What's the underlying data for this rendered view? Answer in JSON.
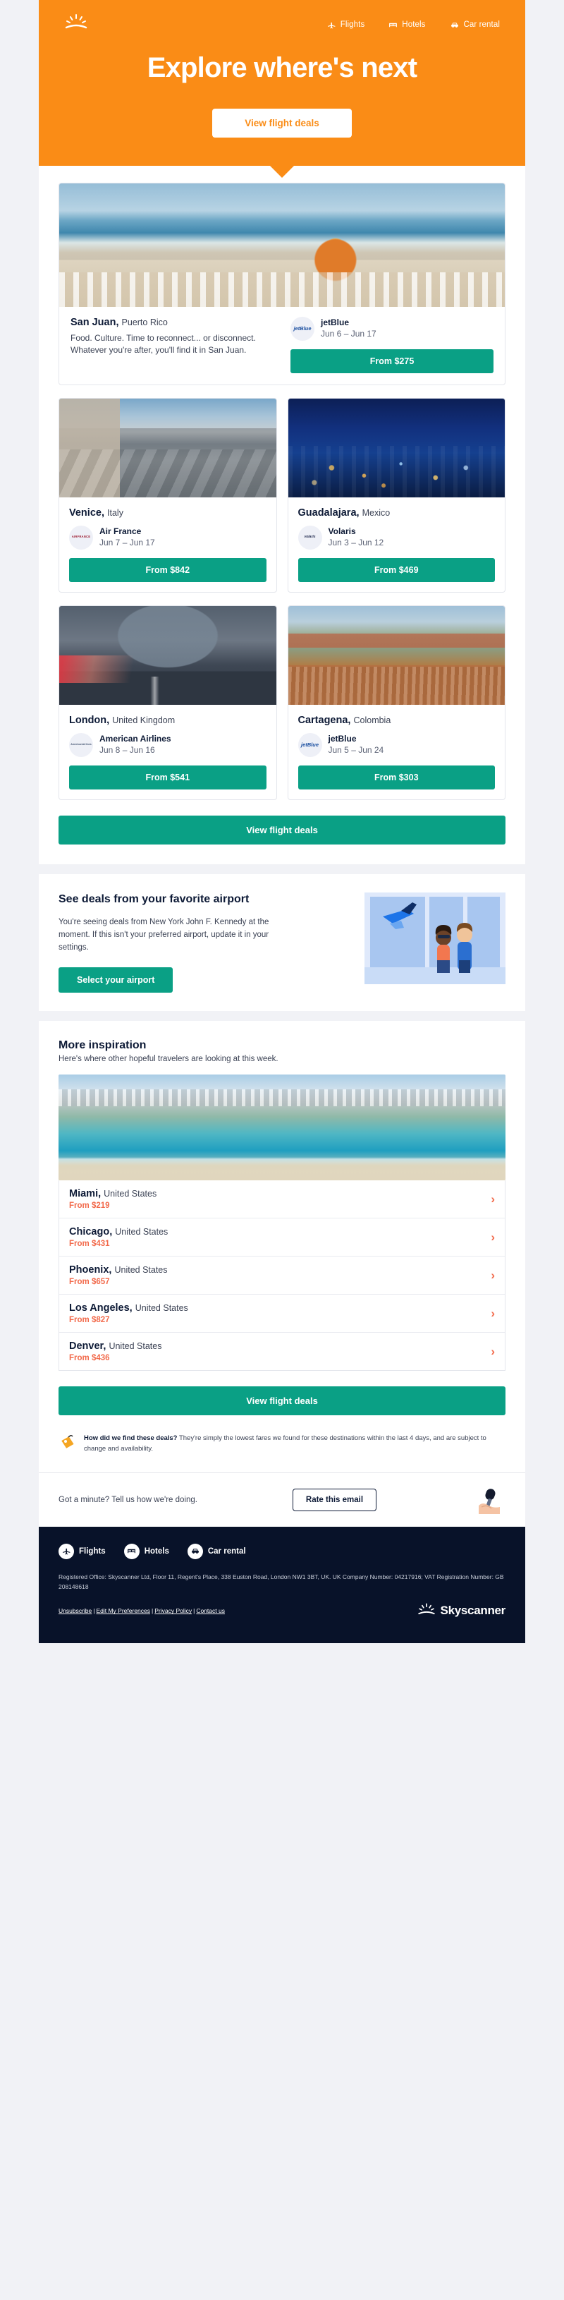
{
  "hero": {
    "logo_icon": "skyscanner-sun-icon",
    "nav": [
      {
        "label": "Flights",
        "icon": "plane-icon"
      },
      {
        "label": "Hotels",
        "icon": "bed-icon"
      },
      {
        "label": "Car rental",
        "icon": "car-icon"
      }
    ],
    "title": "Explore where's next",
    "cta": "View flight deals",
    "bg_color": "#fa8c16"
  },
  "featured": {
    "name": "San Juan,",
    "country": "Puerto Rico",
    "description": "Food. Culture. Time to reconnect... or disconnect. Whatever you're after, you'll find it in San Juan.",
    "airline": "jetBlue",
    "airline_logo": "jetblue-logo",
    "dates": "Jun 6 – Jun 17",
    "price_label": "From $275",
    "image": "san-juan-coastline-photo"
  },
  "deals": [
    {
      "name": "Venice,",
      "country": "Italy",
      "airline": "Air France",
      "airline_logo": "air-france-logo",
      "dates": "Jun 7 – Jun 17",
      "price_label": "From $842",
      "image": "venice-piazza-photo"
    },
    {
      "name": "Guadalajara,",
      "country": "Mexico",
      "airline": "Volaris",
      "airline_logo": "volaris-logo",
      "dates": "Jun 3 – Jun 12",
      "price_label": "From $469",
      "image": "guadalajara-skyline-night-photo"
    },
    {
      "name": "London,",
      "country": "United Kingdom",
      "airline": "American Airlines",
      "airline_logo": "american-airlines-logo",
      "dates": "Jun 8 – Jun 16",
      "price_label": "From $541",
      "image": "london-tower-bridge-photo"
    },
    {
      "name": "Cartagena,",
      "country": "Colombia",
      "airline": "jetBlue",
      "airline_logo": "jetblue-logo",
      "dates": "Jun 5 – Jun 24",
      "price_label": "From $303",
      "image": "cartagena-rooftops-photo"
    }
  ],
  "deals_cta": "View flight deals",
  "airport_section": {
    "title": "See deals from your favorite airport",
    "body": "You're seeing deals from New York John F. Kennedy at the moment. If this isn't your preferred airport, update it in your settings.",
    "button": "Select your airport",
    "illustration": "airport-window-travelers-illustration"
  },
  "inspiration": {
    "title": "More inspiration",
    "subtitle": "Here's where other hopeful travelers are looking at this week.",
    "image": "miami-beach-aerial-photo",
    "rows": [
      {
        "name": "Miami,",
        "country": "United States",
        "price": "From $219",
        "chevron": "chevron-right-icon"
      },
      {
        "name": "Chicago,",
        "country": "United States",
        "price": "From $431",
        "chevron": "chevron-right-icon"
      },
      {
        "name": "Phoenix,",
        "country": "United States",
        "price": "From $657",
        "chevron": "chevron-right-icon"
      },
      {
        "name": "Los Angeles,",
        "country": "United States",
        "price": "From $827",
        "chevron": "chevron-right-icon"
      },
      {
        "name": "Denver,",
        "country": "United States",
        "price": "From $436",
        "chevron": "chevron-right-icon"
      }
    ],
    "cta": "View flight deals"
  },
  "disclaimer": {
    "icon": "price-tag-icon",
    "lead": "How did we find these deals?",
    "body": " They're simply the lowest fares we found for these destinations within the last 4 days, and are subject to change and availability."
  },
  "rate": {
    "text": "Got a minute? Tell us how we're doing.",
    "button": "Rate this email",
    "illustration": "hand-holding-microphone-illustration"
  },
  "footer": {
    "nav": [
      {
        "label": "Flights",
        "icon": "plane-icon"
      },
      {
        "label": "Hotels",
        "icon": "bed-icon"
      },
      {
        "label": "Car rental",
        "icon": "car-icon"
      }
    ],
    "legal": "Registered Office: Skyscanner Ltd, Floor 11, Regent's Place, 338 Euston Road, London NW1 3BT, UK. UK Company Number: 04217916; VAT Registration Number: GB 208148618",
    "links": [
      {
        "label": "Unsubscribe"
      },
      {
        "label": "Edit My Preferences"
      },
      {
        "label": "Privacy Policy"
      },
      {
        "label": "Contact us"
      }
    ],
    "separator": "|",
    "brand": "Skyscanner",
    "brand_icon": "skyscanner-sun-icon",
    "bg_color": "#081229"
  },
  "colors": {
    "orange": "#fa8c16",
    "teal": "#0aa085",
    "navy": "#0d1a36",
    "coral": "#f26a4b"
  }
}
